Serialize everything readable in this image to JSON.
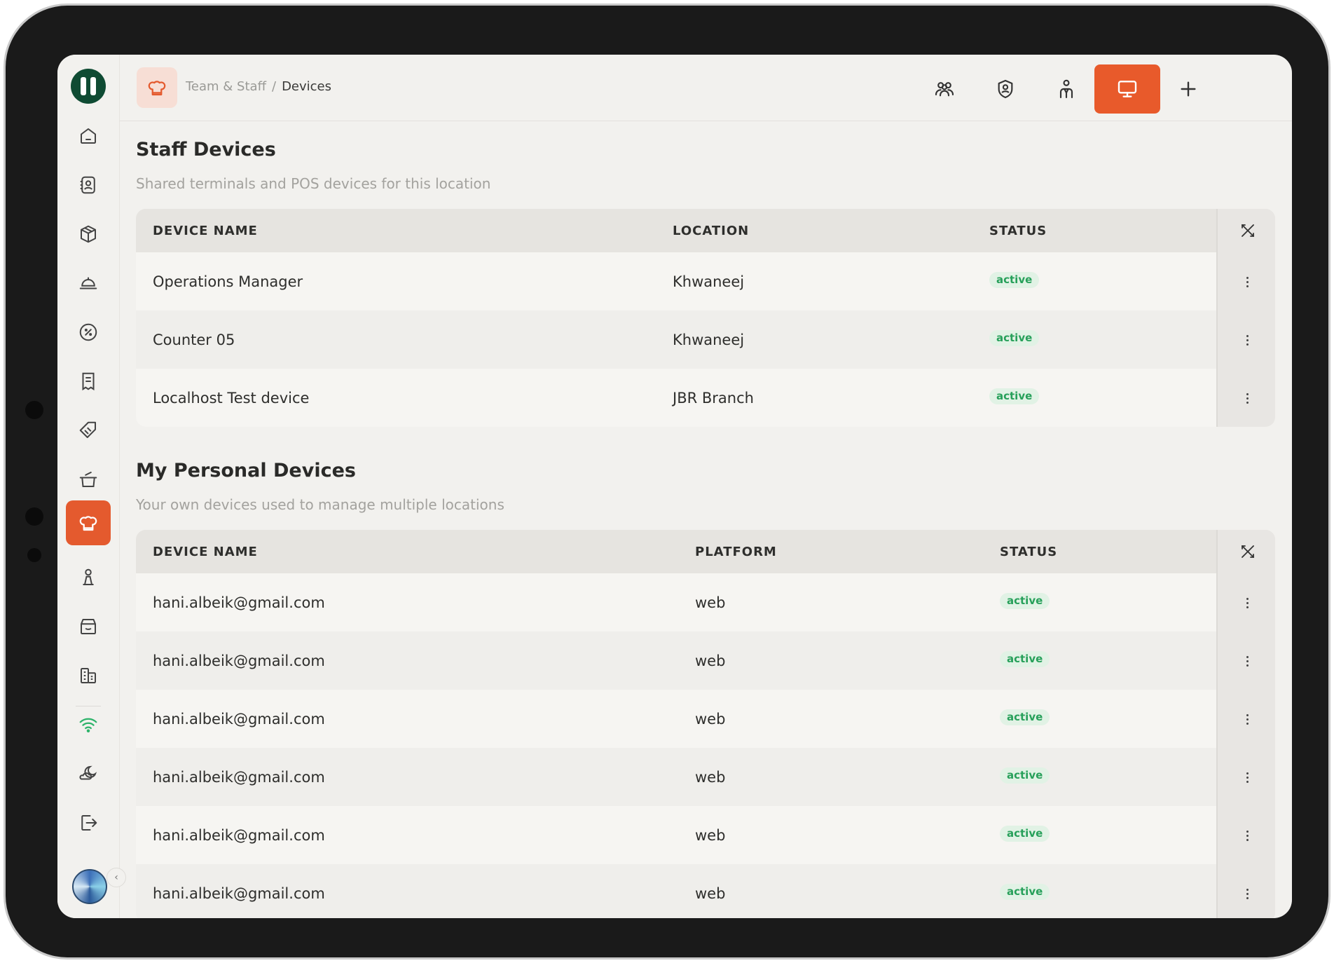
{
  "breadcrumb": {
    "parent": "Team & Staff",
    "separator": "/",
    "current": "Devices"
  },
  "sidebar": {
    "items": [
      {
        "icon": "home-icon"
      },
      {
        "icon": "contacts-icon"
      },
      {
        "icon": "box-icon"
      },
      {
        "icon": "delivery-icon"
      },
      {
        "icon": "discount-icon"
      },
      {
        "icon": "receipt-icon"
      },
      {
        "icon": "tag-icon"
      },
      {
        "icon": "pot-icon"
      },
      {
        "icon": "chef-hat-icon",
        "active": true
      },
      {
        "icon": "award-icon"
      },
      {
        "icon": "store-icon"
      },
      {
        "icon": "building-icon"
      },
      {
        "icon": "wifi-icon"
      },
      {
        "icon": "moon-cloud-icon"
      },
      {
        "icon": "logout-icon"
      }
    ]
  },
  "topbar": {
    "actions": [
      {
        "icon": "team-icon"
      },
      {
        "icon": "shield-user-icon"
      },
      {
        "icon": "staff-member-icon"
      },
      {
        "icon": "monitor-icon",
        "active": true
      },
      {
        "icon": "plus-icon"
      }
    ]
  },
  "staff_devices": {
    "title": "Staff Devices",
    "subtitle": "Shared terminals and POS devices for this location",
    "columns": [
      "DEVICE NAME",
      "LOCATION",
      "STATUS"
    ],
    "rows": [
      {
        "name": "Operations Manager",
        "location": "Khwaneej",
        "status": "active"
      },
      {
        "name": "Counter 05",
        "location": "Khwaneej",
        "status": "active"
      },
      {
        "name": "Localhost Test device",
        "location": "JBR Branch",
        "status": "active"
      }
    ]
  },
  "personal_devices": {
    "title": "My Personal Devices",
    "subtitle": "Your own devices used to manage multiple locations",
    "columns": [
      "DEVICE NAME",
      "PLATFORM",
      "STATUS"
    ],
    "rows": [
      {
        "name": "hani.albeik@gmail.com",
        "platform": "web",
        "status": "active"
      },
      {
        "name": "hani.albeik@gmail.com",
        "platform": "web",
        "status": "active"
      },
      {
        "name": "hani.albeik@gmail.com",
        "platform": "web",
        "status": "active"
      },
      {
        "name": "hani.albeik@gmail.com",
        "platform": "web",
        "status": "active"
      },
      {
        "name": "hani.albeik@gmail.com",
        "platform": "web",
        "status": "active"
      },
      {
        "name": "hani.albeik@gmail.com",
        "platform": "web",
        "status": "active"
      }
    ]
  },
  "colors": {
    "accent": "#e85a2b",
    "brand": "#0f4b33",
    "status_active": "#27a05a"
  }
}
